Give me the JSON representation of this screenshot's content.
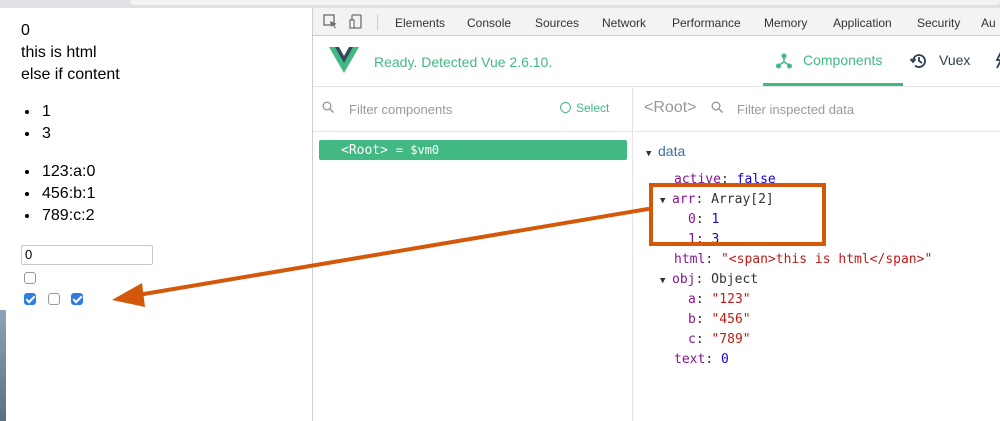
{
  "page": {
    "line1": "0",
    "line2": "this is html",
    "line3": "else if content",
    "list1": [
      "1",
      "3"
    ],
    "list2": [
      "123:a:0",
      "456:b:1",
      "789:c:2"
    ],
    "input_value": "0",
    "checkboxes": [
      false,
      true,
      false,
      true
    ]
  },
  "devtools": {
    "tabs": [
      "Elements",
      "Console",
      "Sources",
      "Network",
      "Performance",
      "Memory",
      "Application",
      "Security",
      "Au"
    ],
    "inspect_icon": "cursor-select-icon",
    "device_icon": "device-toggle-icon"
  },
  "vue": {
    "status": "Ready. Detected Vue 2.6.10.",
    "tab_components": "Components",
    "tab_vuex": "Vuex",
    "accent": "#42b983",
    "filter_components": "Filter components",
    "select_label": "Select",
    "root_crumb": "<Root>",
    "filter_inspected": "Filter inspected data",
    "root_node": "<Root>",
    "root_ref": "= $vm0"
  },
  "inspector": {
    "section": "data",
    "active_key": "active",
    "active_val": "false",
    "arr_key": "arr",
    "arr_type": "Array[2]",
    "arr_items": [
      {
        "i": "0",
        "v": "1"
      },
      {
        "i": "1",
        "v": "3"
      }
    ],
    "html_key": "html",
    "html_val": "\"<span>this is html</span>\"",
    "obj_key": "obj",
    "obj_type": "Object",
    "obj_items": [
      {
        "k": "a",
        "v": "\"123\""
      },
      {
        "k": "b",
        "v": "\"456\""
      },
      {
        "k": "c",
        "v": "\"789\""
      }
    ],
    "text_key": "text",
    "text_val": "0"
  },
  "annotation": {
    "color": "#d4580a"
  }
}
